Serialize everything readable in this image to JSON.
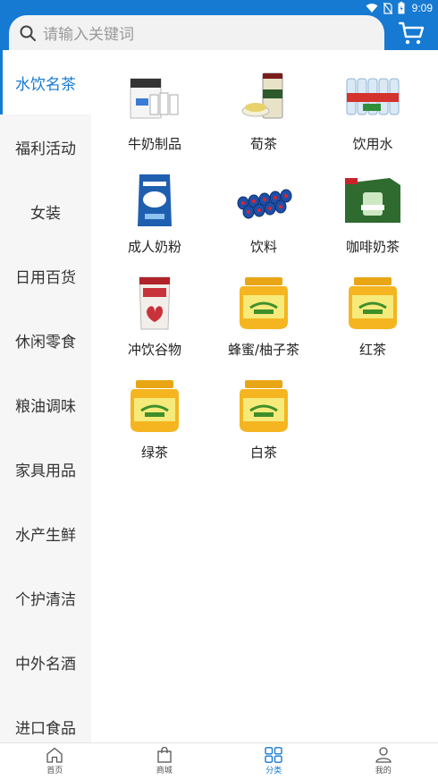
{
  "status_bar": {
    "time": "9:09"
  },
  "search": {
    "placeholder": "请输入关键词"
  },
  "sidebar": {
    "items": [
      {
        "label": "水饮名茶",
        "active": true
      },
      {
        "label": "福利活动"
      },
      {
        "label": "女装"
      },
      {
        "label": "日用百货"
      },
      {
        "label": "休闲零食"
      },
      {
        "label": "粮油调味"
      },
      {
        "label": "家具用品"
      },
      {
        "label": "水产生鲜"
      },
      {
        "label": "个护清洁"
      },
      {
        "label": "中外名酒"
      },
      {
        "label": "进口食品"
      }
    ]
  },
  "products": [
    {
      "name": "牛奶制品",
      "icon": "milk-box-icon"
    },
    {
      "name": "荀茶",
      "icon": "tea-jar-icon"
    },
    {
      "name": "饮用水",
      "icon": "water-pack-icon"
    },
    {
      "name": "成人奶粉",
      "icon": "milk-powder-icon"
    },
    {
      "name": "饮料",
      "icon": "soda-cans-icon"
    },
    {
      "name": "咖啡奶茶",
      "icon": "coffee-box-icon"
    },
    {
      "name": "冲饮谷物",
      "icon": "cereal-bag-icon"
    },
    {
      "name": "蜂蜜/柚子茶",
      "icon": "honey-jar-icon"
    },
    {
      "name": "红茶",
      "icon": "honey-jar-icon"
    },
    {
      "name": "绿茶",
      "icon": "honey-jar-icon"
    },
    {
      "name": "白茶",
      "icon": "honey-jar-icon"
    }
  ],
  "bottom_nav": [
    {
      "label": "首页",
      "icon": "home-icon"
    },
    {
      "label": "商城",
      "icon": "shopping-bag-icon"
    },
    {
      "label": "分类",
      "icon": "category-grid-icon",
      "active": true
    },
    {
      "label": "我的",
      "icon": "user-icon"
    }
  ],
  "colors": {
    "brand": "#1679d2",
    "sidebar_bg": "#f6f6f6"
  }
}
